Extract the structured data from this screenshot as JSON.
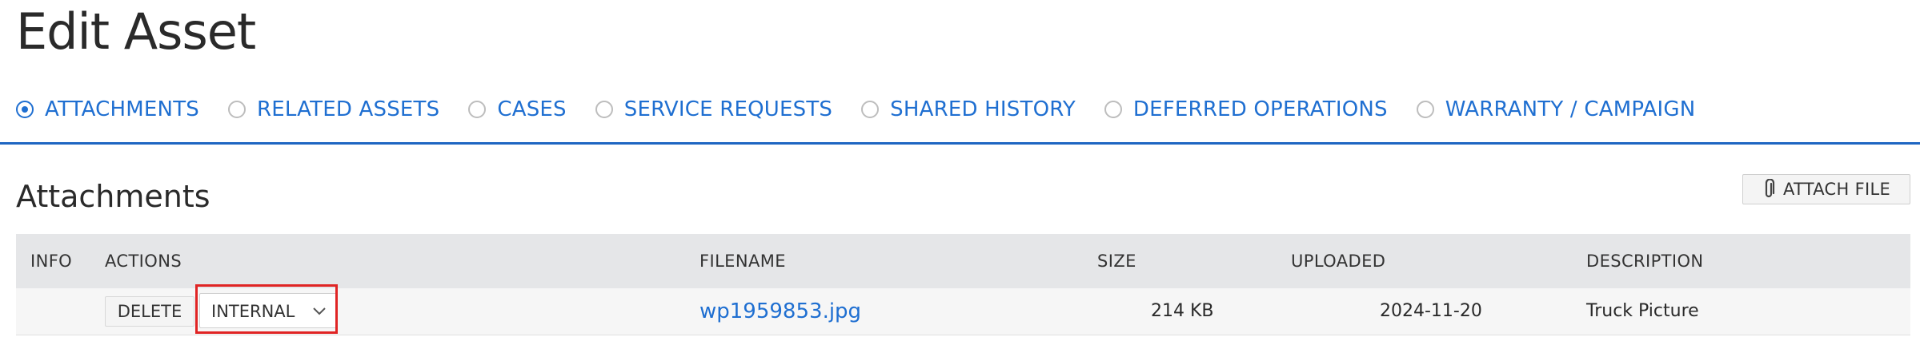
{
  "page": {
    "title": "Edit Asset"
  },
  "tabs": [
    {
      "label": "ATTACHMENTS",
      "selected": true
    },
    {
      "label": "RELATED ASSETS",
      "selected": false
    },
    {
      "label": "CASES",
      "selected": false
    },
    {
      "label": "SERVICE REQUESTS",
      "selected": false
    },
    {
      "label": "SHARED HISTORY",
      "selected": false
    },
    {
      "label": "DEFERRED OPERATIONS",
      "selected": false
    },
    {
      "label": "WARRANTY / CAMPAIGN",
      "selected": false
    }
  ],
  "attachments": {
    "title": "Attachments",
    "attach_button_label": "ATTACH FILE",
    "attach_icon": "paperclip-icon",
    "columns": {
      "info": "INFO",
      "actions": "ACTIONS",
      "filename": "FILENAME",
      "size": "SIZE",
      "uploaded": "UPLOADED",
      "description": "DESCRIPTION"
    },
    "rows": [
      {
        "delete_label": "DELETE",
        "visibility": "INTERNAL",
        "filename": "wp1959853.jpg",
        "size": "214 KB",
        "uploaded": "2024-11-20",
        "description": "Truck Picture"
      }
    ]
  },
  "colors": {
    "accent": "#1f6fd1",
    "rule": "#1e66c2",
    "header_bg": "#e5e6e8",
    "highlight": "#e02424"
  }
}
